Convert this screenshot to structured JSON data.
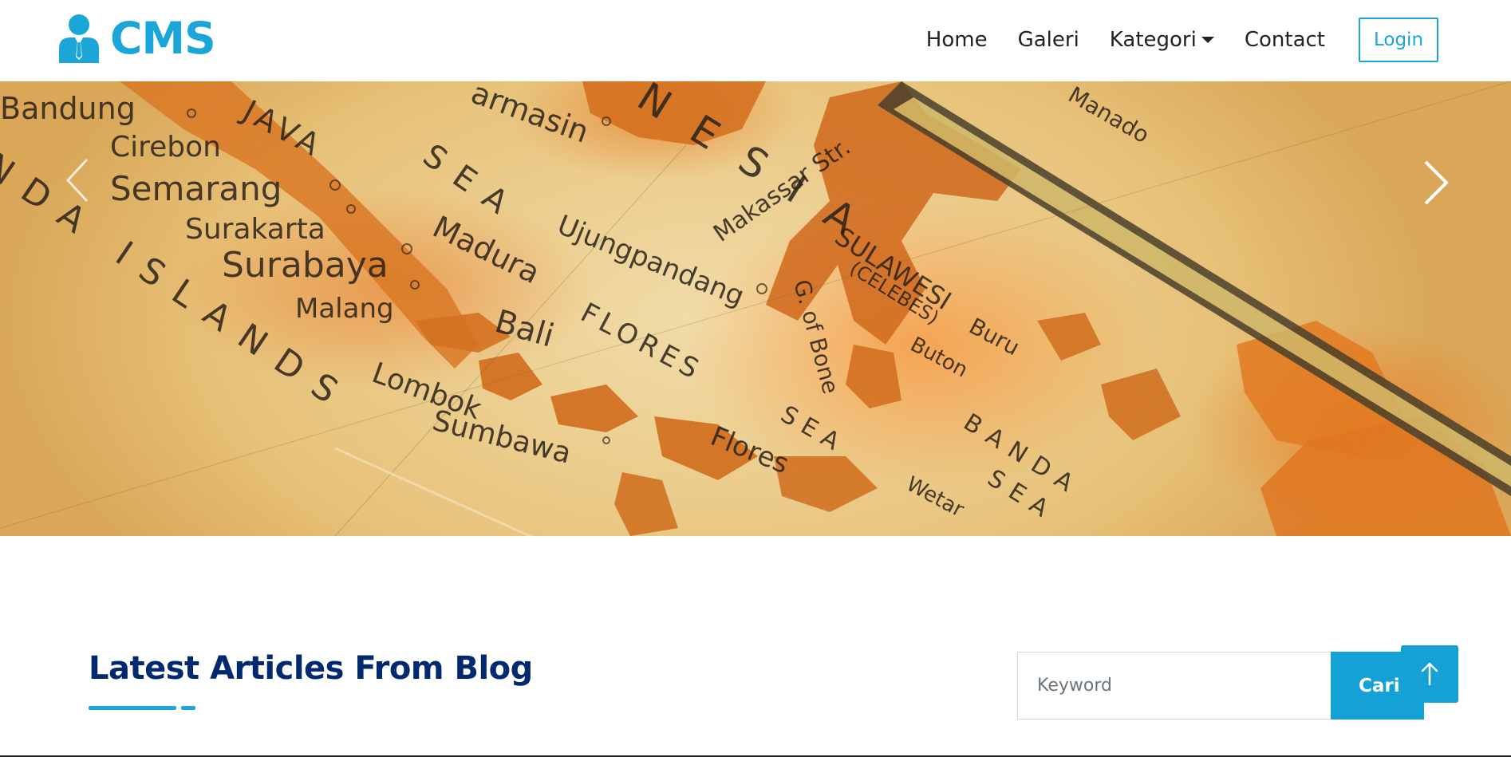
{
  "brand": {
    "name": "CMS",
    "icon": "user-tie-icon"
  },
  "nav": {
    "items": [
      {
        "label": "Home"
      },
      {
        "label": "Galeri"
      },
      {
        "label": "Kategori",
        "has_dropdown": true
      },
      {
        "label": "Contact"
      }
    ],
    "login_label": "Login"
  },
  "hero": {
    "map_labels": [
      "Bandung",
      "JAVA",
      "Cirebon",
      "Semarang",
      "Surakarta",
      "Surabaya",
      "Malang",
      "Madura",
      "Bali",
      "Lombok",
      "Sumbawa",
      "SEA",
      "Ujungpandang",
      "FLORES",
      "Makassar Str.",
      "SULAWESI",
      "(CELEBES)",
      "G. of Bone",
      "SEA",
      "Flores",
      "Buton",
      "Buru",
      "BANDA",
      "SEA",
      "Wetar",
      "armasin",
      "NESIA",
      "NDA ISLANDS",
      "Manado"
    ],
    "prev_icon": "chevron-left-icon",
    "next_icon": "chevron-right-icon"
  },
  "articles": {
    "title": "Latest Articles From Blog"
  },
  "search": {
    "placeholder": "Keyword",
    "button_label": "Cari"
  },
  "back_to_top": {
    "icon": "arrow-up-icon"
  },
  "colors": {
    "accent": "#1aa6d9",
    "heading": "#012970",
    "nav_text": "#222222"
  }
}
